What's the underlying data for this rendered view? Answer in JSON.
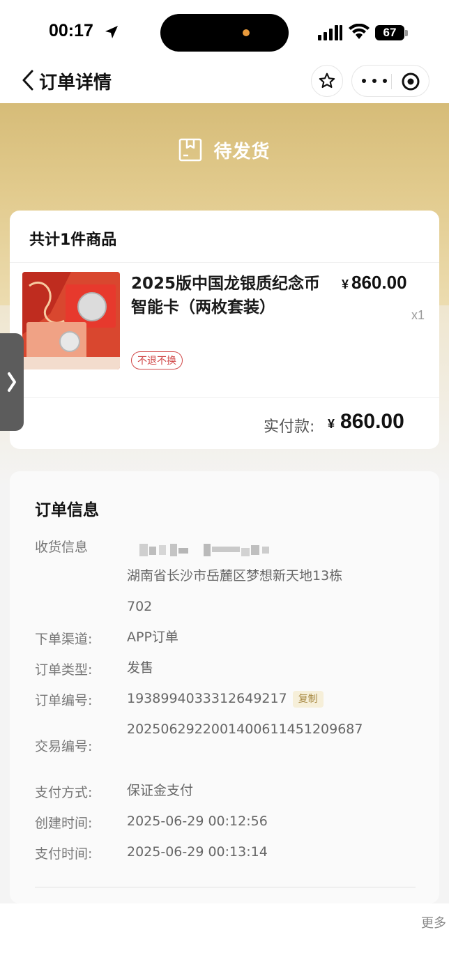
{
  "status_bar": {
    "time": "00:17",
    "battery": "67"
  },
  "nav": {
    "title": "订单详情"
  },
  "order_status": "待发货",
  "product_card": {
    "title": "共计1件商品",
    "product_name": "2025版中国龙银质纪念币智能卡（两枚套装）",
    "price_symbol": "¥",
    "price": "860.00",
    "quantity": "x1",
    "tag": "不退不换",
    "paid_label": "实付款:",
    "paid_symbol": "¥",
    "paid_amount": "860.00"
  },
  "order_info": {
    "title": "订单信息",
    "rows": [
      {
        "label": "收货信息",
        "value": "湖南省长沙市岳麓区梦想新天地13栋",
        "value2": "702"
      },
      {
        "label": "下单渠道:",
        "value": "APP订单"
      },
      {
        "label": "订单类型:",
        "value": "发售"
      },
      {
        "label": "订单编号:",
        "value": "1938994033312649217",
        "action": "复制"
      },
      {
        "label": "交易编号:",
        "value": "2025062922001400611451209687"
      },
      {
        "label": "支付方式:",
        "value": "保证金支付"
      },
      {
        "label": "创建时间:",
        "value": "2025-06-29 00:12:56"
      },
      {
        "label": "支付时间:",
        "value": "2025-06-29 00:13:14"
      }
    ]
  },
  "footer": {
    "more": "更多"
  },
  "colors": {
    "gold": "#d6bc78",
    "tag_red": "#d04646",
    "copy_gold": "#a88a45"
  }
}
